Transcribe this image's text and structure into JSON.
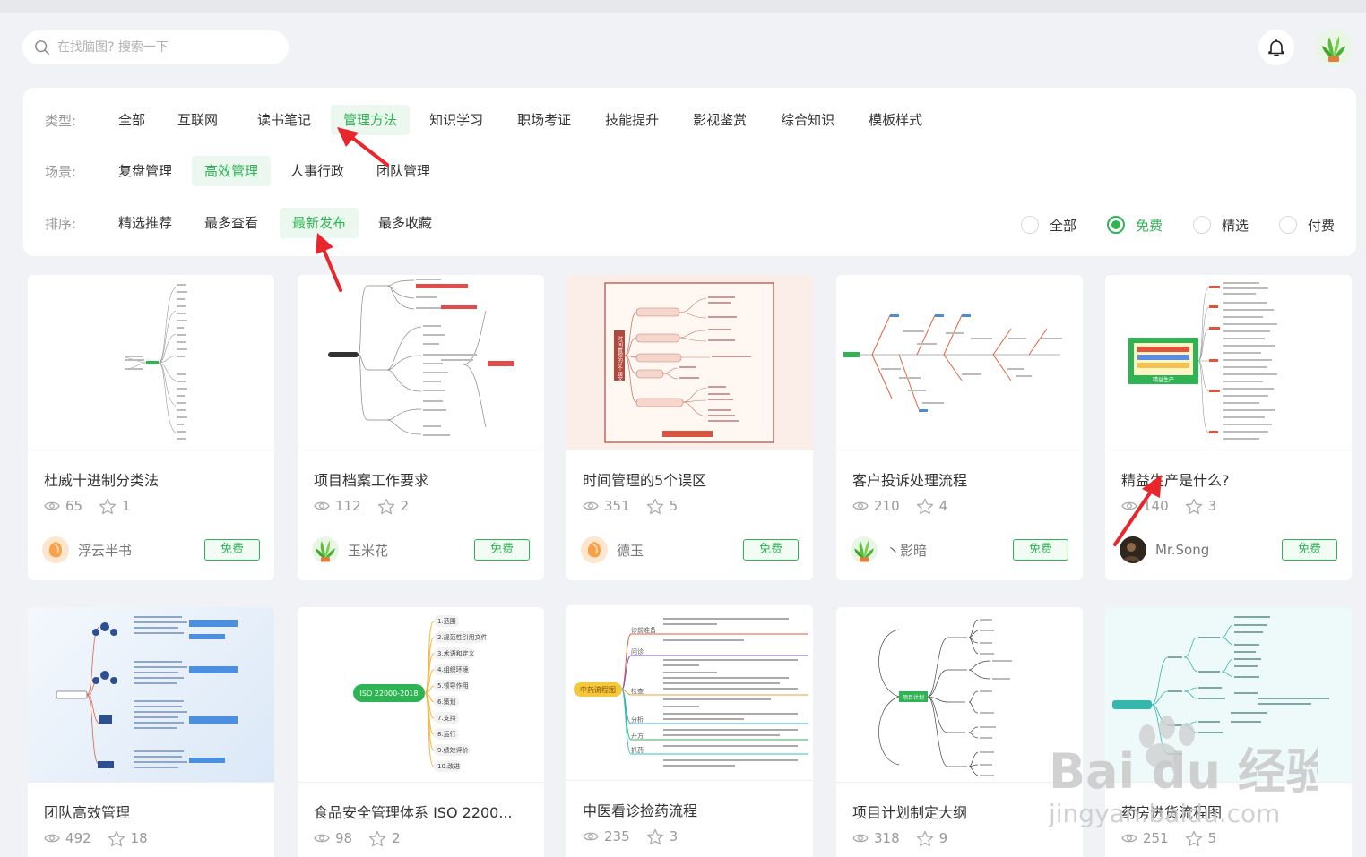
{
  "search": {
    "placeholder": "在找脑图? 搜索一下"
  },
  "filters": {
    "type_label": "类型:",
    "types": [
      "全部",
      "互联网",
      "读书笔记",
      "管理方法",
      "知识学习",
      "职场考证",
      "技能提升",
      "影视鉴赏",
      "综合知识",
      "模板样式"
    ],
    "type_active": "管理方法",
    "scene_label": "场景:",
    "scenes": [
      "复盘管理",
      "高效管理",
      "人事行政",
      "团队管理"
    ],
    "scene_active": "高效管理",
    "sort_label": "排序:",
    "sorts": [
      "精选推荐",
      "最多查看",
      "最新发布",
      "最多收藏"
    ],
    "sort_active": "最新发布",
    "price": [
      "全部",
      "免费",
      "精选",
      "付费"
    ],
    "price_active": "免费"
  },
  "cards": [
    {
      "title": "杜威十进制分类法",
      "views": "65",
      "stars": "1",
      "author": "浮云半书",
      "badge": "免费",
      "avatar": "orange"
    },
    {
      "title": "项目档案工作要求",
      "views": "112",
      "stars": "2",
      "author": "玉米花",
      "badge": "免费",
      "avatar": "plant"
    },
    {
      "title": "时间管理的5个误区",
      "views": "351",
      "stars": "5",
      "author": "德玉",
      "badge": "免费",
      "avatar": "orange"
    },
    {
      "title": "客户投诉处理流程",
      "views": "210",
      "stars": "4",
      "author": "丶影暗",
      "badge": "免费",
      "avatar": "plant"
    },
    {
      "title": "精益生产是什么?",
      "views": "140",
      "stars": "3",
      "author": "Mr.Song",
      "badge": "免费",
      "avatar": "dark"
    },
    {
      "title": "团队高效管理",
      "views": "492",
      "stars": "18"
    },
    {
      "title": "食品安全管理体系 ISO 2200...",
      "views": "98",
      "stars": "2"
    },
    {
      "title": "中医看诊捡药流程",
      "views": "235",
      "stars": "3"
    },
    {
      "title": "项目计划制定大纲",
      "views": "318",
      "stars": "9"
    },
    {
      "title": "药房进货流程图",
      "views": "251",
      "stars": "5"
    }
  ],
  "thumbs": {
    "iso_label": "ISO 22000-2018",
    "iso_items": [
      "1.范围",
      "2.规范性引用文件",
      "3.术语和定义",
      "4.组织环境",
      "5.领导作用",
      "6.策划",
      "7.支持",
      "8.运行",
      "9.绩效评价",
      "10.改进"
    ],
    "tcm_label": "中药流程图",
    "tcm_branches": [
      "诊前准备",
      "问诊",
      "检查",
      "分析",
      "开方",
      "抓药"
    ],
    "time_center": "时间管理的5个误区",
    "lean_center": "精益生产",
    "plan_center": "项目计划"
  },
  "watermark": {
    "main": "Bai du 经验",
    "sub": "jingyan.baidu.com"
  },
  "colors": {
    "accent": "#2fb454",
    "arrow": "#e8262b"
  }
}
